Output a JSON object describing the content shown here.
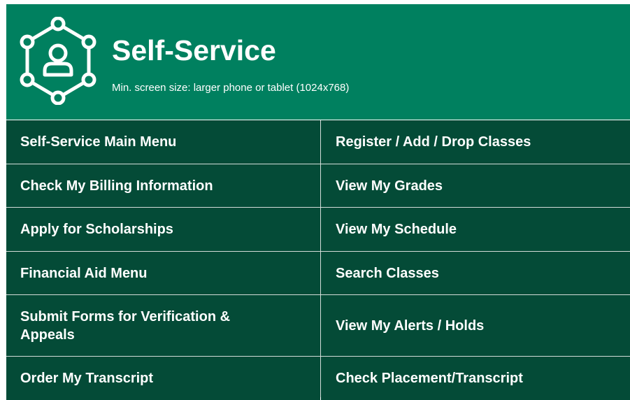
{
  "header": {
    "title": "Self-Service",
    "subtitle": "Min. screen size: larger phone or tablet (1024x768)",
    "icon": "user-network-icon",
    "background_color": "#00805f"
  },
  "menu": {
    "background_color": "#044b37",
    "items": [
      {
        "label": "Self-Service Main Menu"
      },
      {
        "label": "Register / Add / Drop Classes"
      },
      {
        "label": "Check My Billing Information"
      },
      {
        "label": "View My Grades"
      },
      {
        "label": "Apply for Scholarships"
      },
      {
        "label": "View My Schedule"
      },
      {
        "label": "Financial Aid Menu"
      },
      {
        "label": "Search Classes"
      },
      {
        "label": "Submit Forms for Verification & Appeals"
      },
      {
        "label": "View My Alerts / Holds"
      },
      {
        "label": "Order My Transcript"
      },
      {
        "label": "Check Placement/Transcript"
      }
    ]
  }
}
